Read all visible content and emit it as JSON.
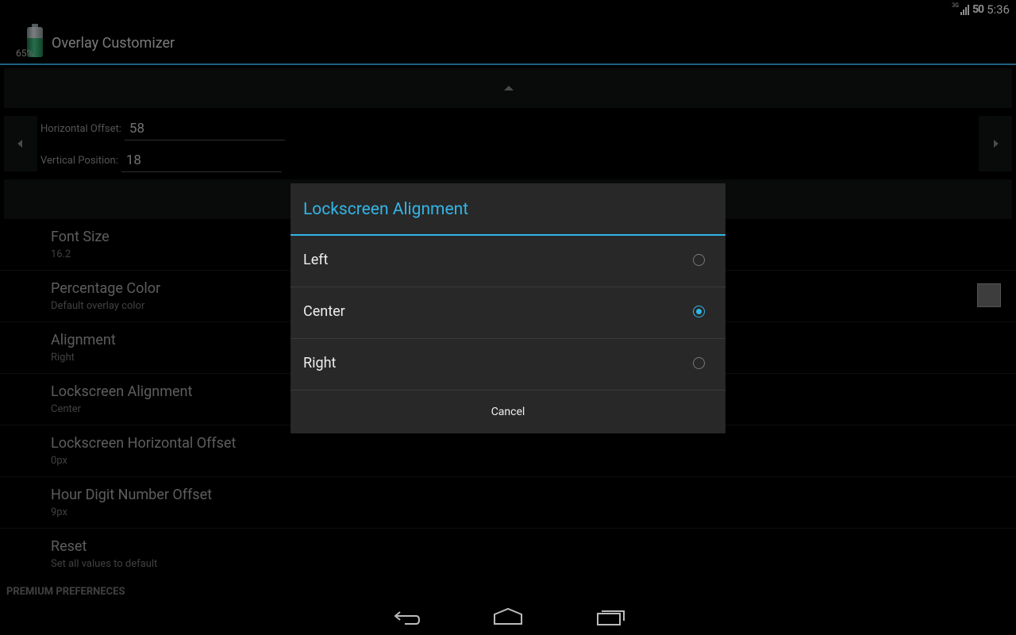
{
  "status_bar": {
    "network_type": "3G",
    "battery_level": "50",
    "time": "5:36"
  },
  "action_bar": {
    "app_icon_percent": "65%",
    "title": "Overlay Customizer"
  },
  "position_panel": {
    "horizontal_offset_label": "Horizontal Offset:",
    "horizontal_offset_value": "58",
    "vertical_position_label": "Vertical Position:",
    "vertical_position_value": "18"
  },
  "preferences": [
    {
      "title": "Font Size",
      "summary": "16.2"
    },
    {
      "title": "Percentage Color",
      "summary": "Default overlay color"
    },
    {
      "title": "Alignment",
      "summary": "Right"
    },
    {
      "title": "Lockscreen Alignment",
      "summary": "Center"
    },
    {
      "title": "Lockscreen Horizontal Offset",
      "summary": "0px"
    },
    {
      "title": "Hour Digit Number Offset",
      "summary": "9px"
    },
    {
      "title": "Reset",
      "summary": "Set all values to default"
    }
  ],
  "category_label": "PREMIUM PREFERNECES",
  "dialog": {
    "title": "Lockscreen Alignment",
    "options": [
      {
        "label": "Left",
        "checked": false
      },
      {
        "label": "Center",
        "checked": true
      },
      {
        "label": "Right",
        "checked": false
      }
    ],
    "cancel_label": "Cancel"
  },
  "colors": {
    "accent": "#33b5e5",
    "panel_bg": "#0f1511",
    "dialog_bg": "#282828",
    "swatch": "#6f6f6f"
  },
  "icons": [
    "signal-icon",
    "battery-icon",
    "app-battery-icon",
    "collapse-up-icon",
    "arrow-left-icon",
    "arrow-right-icon",
    "back-icon",
    "home-icon",
    "recents-icon"
  ]
}
